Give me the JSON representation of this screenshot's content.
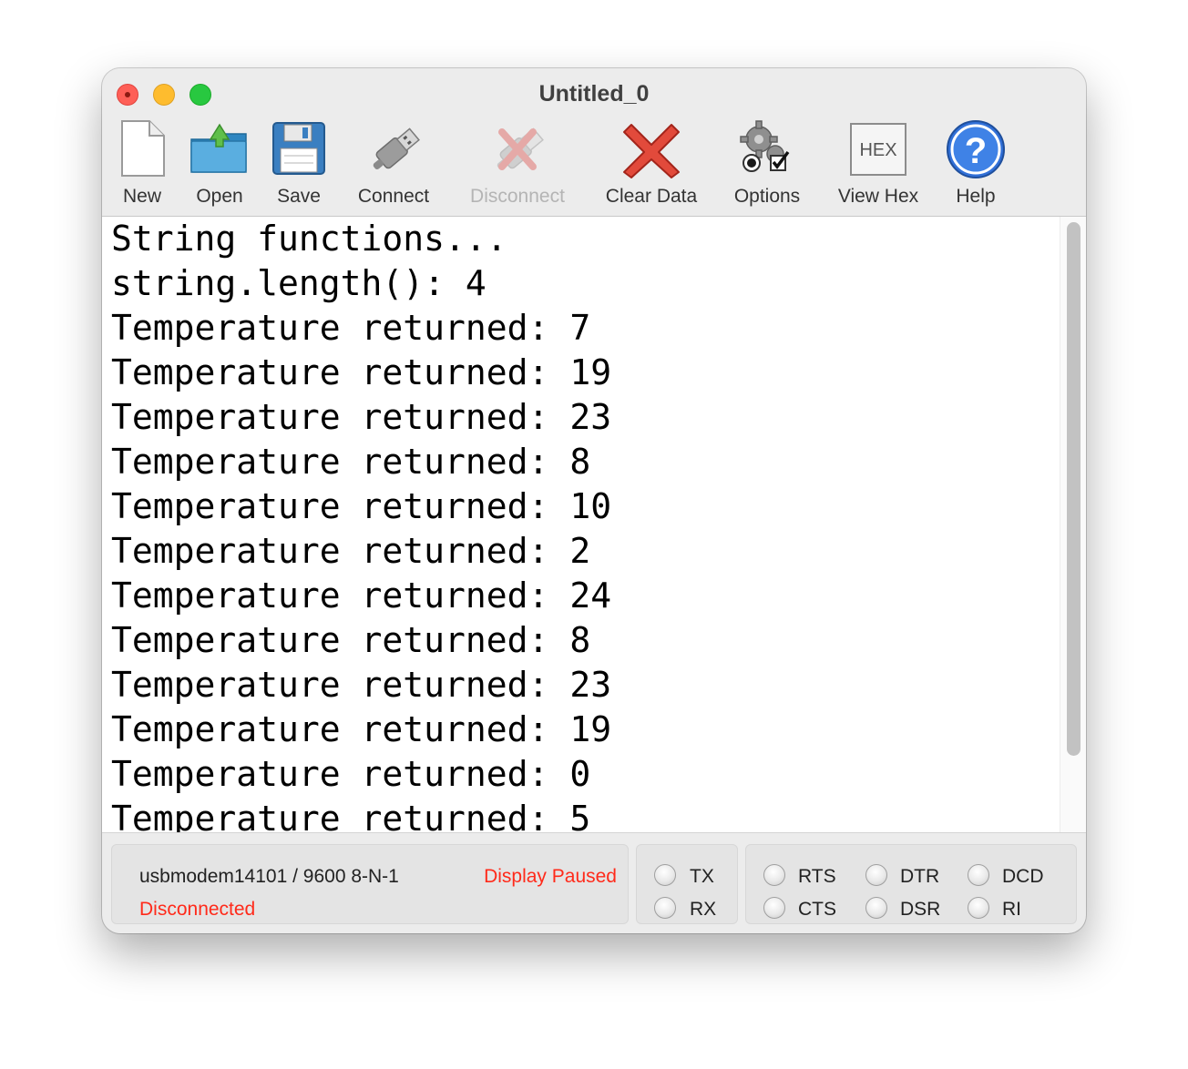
{
  "window": {
    "title": "Untitled_0"
  },
  "toolbar": {
    "items": [
      {
        "label": "New",
        "icon": "new-document-icon",
        "enabled": true
      },
      {
        "label": "Open",
        "icon": "open-folder-icon",
        "enabled": true
      },
      {
        "label": "Save",
        "icon": "floppy-disk-icon",
        "enabled": true
      },
      {
        "label": "Connect",
        "icon": "usb-plug-icon",
        "enabled": true
      },
      {
        "label": "Disconnect",
        "icon": "usb-disconnect-icon",
        "enabled": false
      },
      {
        "label": "Clear Data",
        "icon": "red-x-icon",
        "enabled": true
      },
      {
        "label": "Options",
        "icon": "gears-options-icon",
        "enabled": true
      },
      {
        "label": "View Hex",
        "icon": "hex-icon",
        "enabled": true
      },
      {
        "label": "Help",
        "icon": "help-question-icon",
        "enabled": true
      }
    ],
    "hex_icon_text": "HEX",
    "help_icon_text": "?"
  },
  "console": {
    "lines": [
      "String functions...",
      "string.length(): 4",
      "Temperature returned: 7",
      "Temperature returned: 19",
      "Temperature returned: 23",
      "Temperature returned: 8",
      "Temperature returned: 10",
      "Temperature returned: 2",
      "Temperature returned: 24",
      "Temperature returned: 8",
      "Temperature returned: 23",
      "Temperature returned: 19",
      "Temperature returned: 0",
      "Temperature returned: 5"
    ]
  },
  "status": {
    "port": "usbmodem14101 / 9600 8-N-1",
    "connection": "Disconnected",
    "display_state": "Display Paused",
    "status_color": "#ff2a1a",
    "signals": {
      "tx": "TX",
      "rx": "RX",
      "rts": "RTS",
      "cts": "CTS",
      "dtr": "DTR",
      "dsr": "DSR",
      "dcd": "DCD",
      "ri": "RI"
    }
  }
}
